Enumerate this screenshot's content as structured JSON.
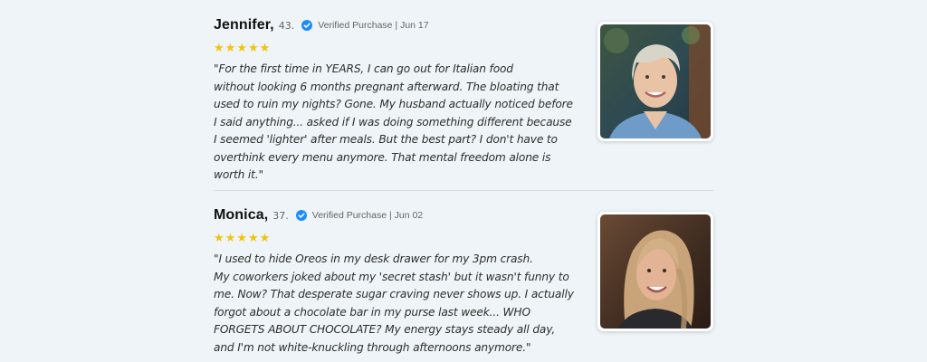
{
  "reviews": [
    {
      "name": "Jennifer,",
      "age": "43.",
      "verified": "Verified Purchase | Jun 17",
      "stars": 5,
      "quote": "\"For the first time in YEARS, I can go out for Italian food\nwithout looking 6 months pregnant afterward. The bloating that\nused to ruin my nights? Gone. My husband actually noticed before\nI said anything... asked if I was doing something different because\nI seemed 'lighter' after meals. But the best part? I don't have to\noverthink every menu anymore. That mental freedom alone is\nworth it.\""
    },
    {
      "name": "Monica,",
      "age": "37.",
      "verified": "Verified Purchase | Jun 02",
      "stars": 5,
      "quote": "\"I used to hide Oreos in my desk drawer for my 3pm crash.\nMy coworkers joked about my 'secret stash' but it wasn't funny to\nme. Now? That desperate sugar craving never shows up. I actually\nforgot about a chocolate bar in my purse last week... WHO\nFORGETS ABOUT CHOCOLATE? My energy stays steady all day,\nand I'm not white-knuckling through afternoons anymore.\""
    }
  ],
  "colors": {
    "background": "#eef4f7",
    "star": "#f4c20d",
    "verified_badge": "#1a8cff"
  },
  "icons": {
    "verified": "verified-check-icon",
    "star": "star-icon"
  }
}
